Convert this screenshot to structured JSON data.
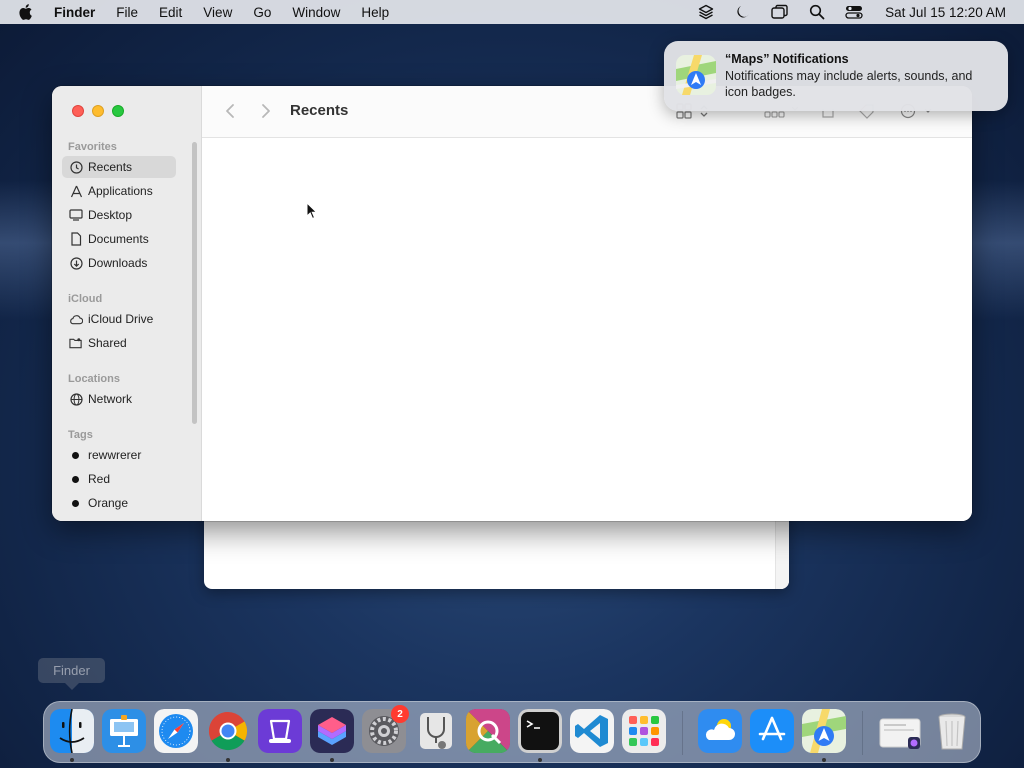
{
  "menubar": {
    "app_name": "Finder",
    "items": [
      "File",
      "Edit",
      "View",
      "Go",
      "Window",
      "Help"
    ],
    "clock": "Sat Jul 15  12:20 AM"
  },
  "finder": {
    "title": "Recents",
    "sidebar": {
      "favorites_title": "Favorites",
      "favorites": [
        "Recents",
        "Applications",
        "Desktop",
        "Documents",
        "Downloads"
      ],
      "icloud_title": "iCloud",
      "icloud": [
        "iCloud Drive",
        "Shared"
      ],
      "locations_title": "Locations",
      "locations": [
        "Network"
      ],
      "tags_title": "Tags",
      "tags": [
        "rewwrerer",
        "Red",
        "Orange"
      ]
    }
  },
  "notification": {
    "title": "“Maps” Notifications",
    "body": "Notifications may include alerts, sounds, and icon badges."
  },
  "dock": {
    "tooltip": "Finder",
    "settings_badge": "2"
  },
  "colors": {
    "close": "#fe5f57",
    "minimize": "#febc2e",
    "maximize": "#28c840",
    "badge": "#ff3b30"
  }
}
